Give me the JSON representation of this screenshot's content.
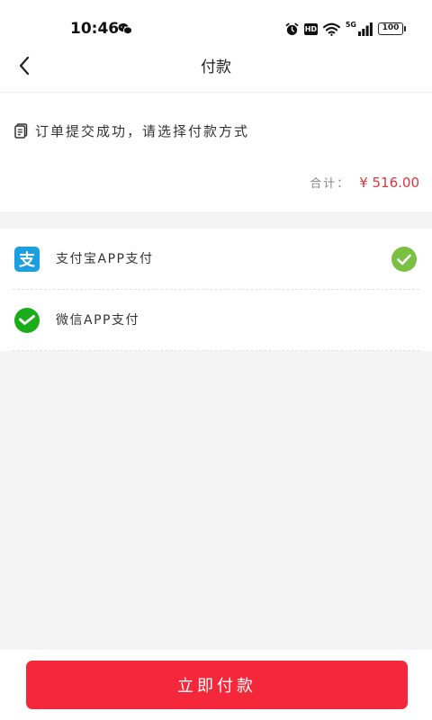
{
  "status_bar": {
    "time": "10:46",
    "hd": "HD",
    "network": "5G",
    "battery": "100"
  },
  "nav": {
    "title": "付款"
  },
  "summary": {
    "message": "订单提交成功，请选择付款方式",
    "total_label": "合计：",
    "total_amount": "¥ 516.00"
  },
  "payment_methods": [
    {
      "label": "支付宝APP支付",
      "icon": "alipay-icon",
      "selected": true
    },
    {
      "label": "微信APP支付",
      "icon": "wechat-pay-icon",
      "selected": false
    }
  ],
  "footer": {
    "pay_button": "立即付款"
  },
  "colors": {
    "accent": "#f5273a",
    "amount": "#e0353f",
    "check": "#7ac143",
    "alipay": "#1d9ee0",
    "wechat": "#1aad19"
  }
}
